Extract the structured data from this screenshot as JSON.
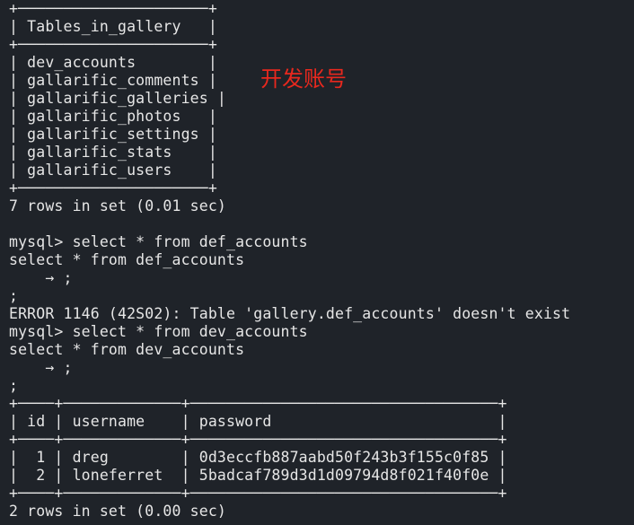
{
  "terminal": {
    "lines": [
      "+─────────────────────+",
      "| Tables_in_gallery   |",
      "+─────────────────────+",
      "| dev_accounts        |",
      "| gallarific_comments |",
      "| gallarific_galleries |",
      "| gallarific_photos   |",
      "| gallarific_settings |",
      "| gallarific_stats    |",
      "| gallarific_users    |",
      "+─────────────────────+",
      "7 rows in set (0.01 sec)",
      "",
      "mysql> select * from def_accounts",
      "select * from def_accounts",
      "    → ;",
      ";",
      "ERROR 1146 (42S02): Table 'gallery.def_accounts' doesn't exist",
      "mysql> select * from dev_accounts",
      "select * from dev_accounts",
      "    → ;",
      ";",
      "+────+─────────────+──────────────────────────────────+",
      "| id | username    | password                         |",
      "+────+─────────────+──────────────────────────────────+",
      "|  1 | dreg        | 0d3eccfb887aabd50f243b3f155c0f85 |",
      "|  2 | loneferret  | 5badcaf789d3d1d09794d8f021f40f0e |",
      "+────+─────────────+──────────────────────────────────+",
      "2 rows in set (0.00 sec)"
    ]
  },
  "annotation": {
    "text": "开发账号",
    "color": "#e8281e"
  },
  "colors": {
    "background": "#1f2329",
    "text": "#e6e6e6"
  }
}
